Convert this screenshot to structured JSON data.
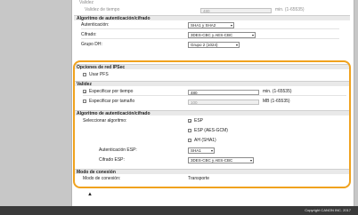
{
  "top": {
    "faded_label": "Validez",
    "faded_row_label": "Validez de tiempo",
    "faded_row_value": "480",
    "faded_row_unit": "min. (1-65535)"
  },
  "auth_top": {
    "title": "Algoritmo de autenticación/cifrado",
    "auth_label": "Autenticación:",
    "auth_value": "SHA1 y SHA2",
    "cipher_label": "Cifrado:",
    "cipher_value": "3DES-CBC y AES-CBC",
    "dh_label": "Grupo DH:",
    "dh_value": "Grupo 2 (1024)"
  },
  "ipsec": {
    "title": "Opciones de red IPSec",
    "pfs_label": "Usar PFS",
    "pfs_checked": false
  },
  "validity": {
    "title": "Validez",
    "by_time_label": "Especificar por tiempo",
    "by_time_checked": true,
    "by_time_value": "480",
    "by_time_unit": "min. (1-65535)",
    "by_size_label": "Especificar por tamaño",
    "by_size_checked": false,
    "by_size_value": "100",
    "by_size_unit": "MB (1-65535)"
  },
  "auth": {
    "title": "Algoritmo de autenticación/cifrado",
    "select_label": "Seleccionar algoritmo:",
    "esp_label": "ESP",
    "esp_checked": true,
    "esp_gcm_label": "ESP (AES-GCM)",
    "esp_gcm_checked": false,
    "ah_label": "AH (SHA1)",
    "ah_checked": false,
    "esp_auth_label": "Autenticación ESP:",
    "esp_auth_value": "SHA1",
    "esp_cipher_label": "Cifrado ESP:",
    "esp_cipher_value": "3DES-CBC y AES-CBC"
  },
  "mode": {
    "title": "Modo de conexión",
    "label": "Modo de conexión:",
    "value": "Transporte"
  },
  "footer": {
    "copyright": "Copyright CANON INC. 2017"
  },
  "check_glyph": "✓",
  "caret_glyph": "▾",
  "top_glyph": "▲"
}
